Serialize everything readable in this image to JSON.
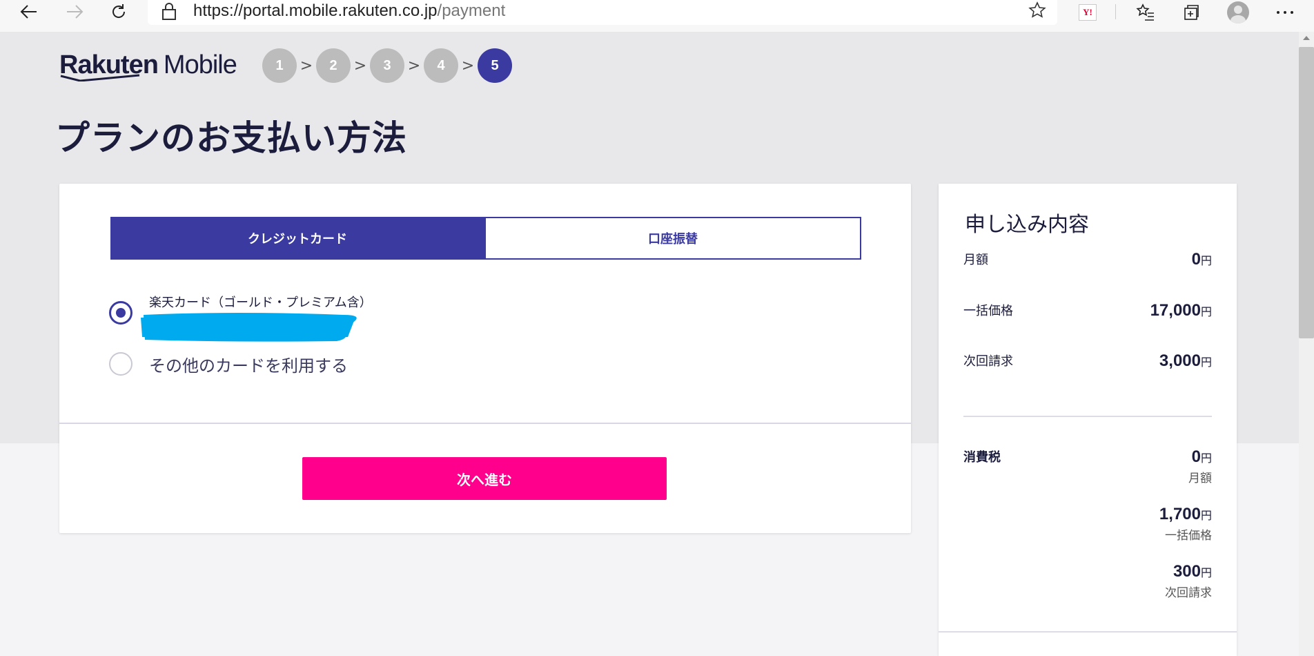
{
  "browser": {
    "url_host": "https://portal.mobile.rakuten.co.jp",
    "url_path": "/payment",
    "ext_label": "Y!"
  },
  "header": {
    "brand_bold": "Rakuten",
    "brand_sub": "Mobile",
    "steps": [
      "1",
      "2",
      "3",
      "4",
      "5"
    ],
    "active_step": 5,
    "separator": ">"
  },
  "page_title": "プランのお支払い方法",
  "payment": {
    "tabs": [
      {
        "label": "クレジットカード",
        "active": true
      },
      {
        "label": "口座振替",
        "active": false
      }
    ],
    "options": [
      {
        "label": "楽天カード（ゴールド・プレミアム含）",
        "checked": true
      },
      {
        "label": "その他のカードを利用する",
        "checked": false
      }
    ],
    "next_button": "次へ進む"
  },
  "summary": {
    "title": "申し込み内容",
    "rows": [
      {
        "label": "月額",
        "value": "0",
        "unit": "円"
      },
      {
        "label": "一括価格",
        "value": "17,000",
        "unit": "円"
      },
      {
        "label": "次回請求",
        "value": "3,000",
        "unit": "円"
      }
    ],
    "tax": {
      "label": "消費税",
      "items": [
        {
          "value": "0",
          "unit": "円",
          "caption": "月額"
        },
        {
          "value": "1,700",
          "unit": "円",
          "caption": "一括価格"
        },
        {
          "value": "300",
          "unit": "円",
          "caption": "次回請求"
        }
      ]
    }
  },
  "colors": {
    "primary": "#3a3aa0",
    "cta": "#ff008c",
    "redaction": "#00aaee"
  }
}
